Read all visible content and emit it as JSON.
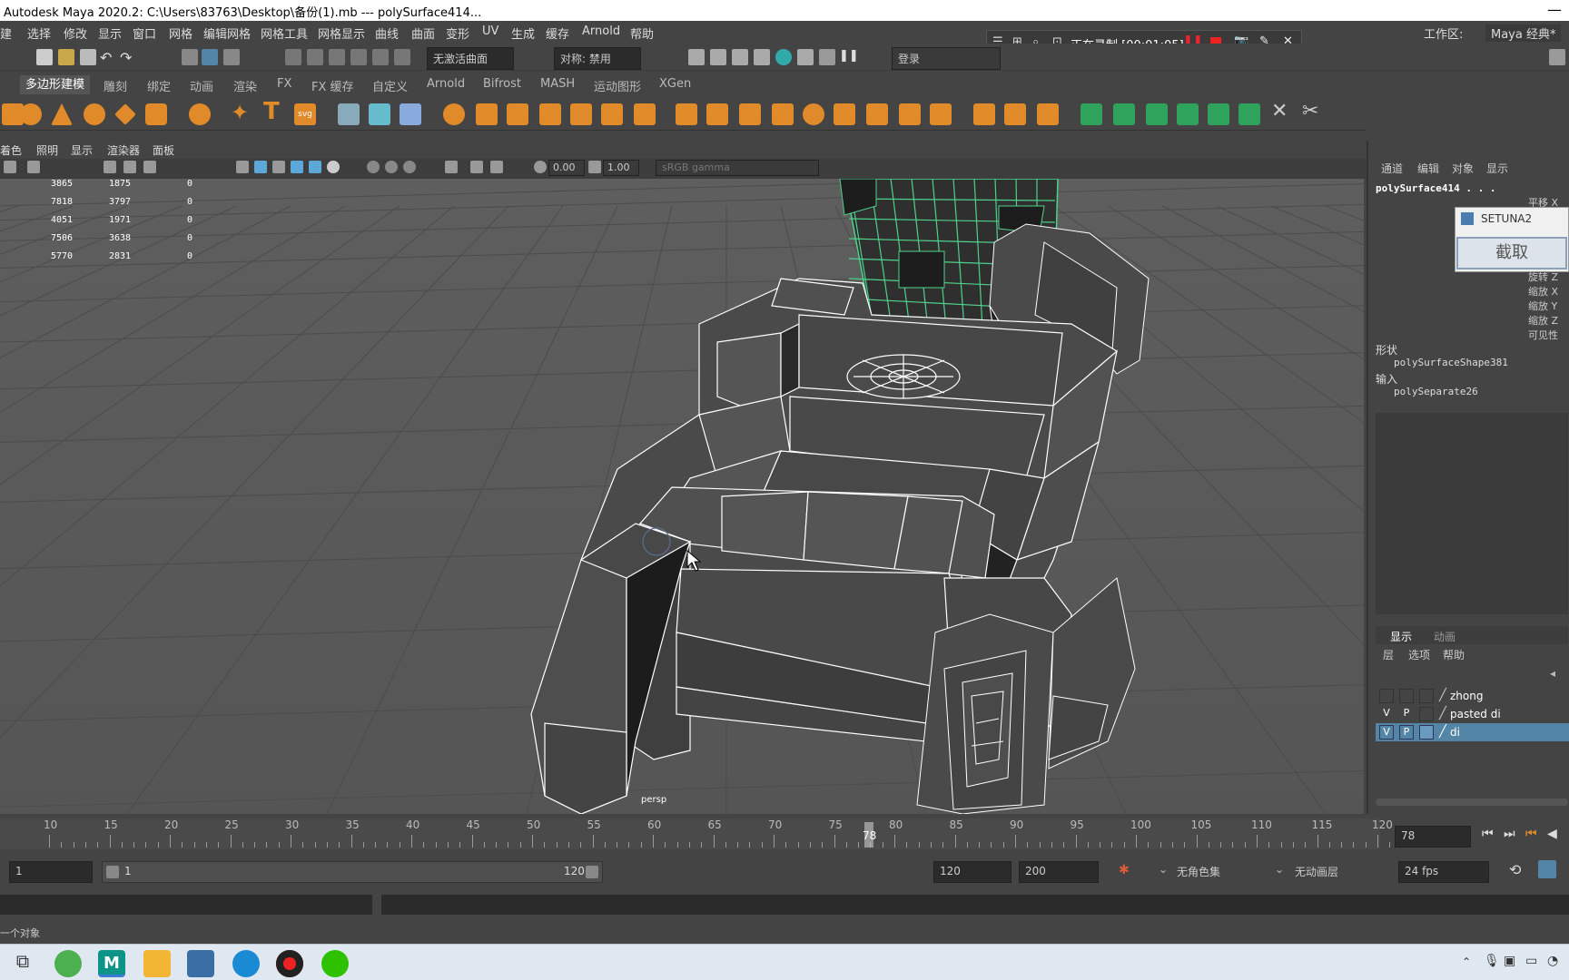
{
  "window": {
    "title": "Autodesk Maya 2020.2: C:\\Users\\83763\\Desktop\\备份(1).mb   ---   polySurface414...",
    "close": "—"
  },
  "menus": [
    "建",
    "选择",
    "修改",
    "显示",
    "窗口",
    "网格",
    "编辑网格",
    "网格工具",
    "网格显示",
    "曲线",
    "曲面",
    "变形",
    "UV",
    "生成",
    "缓存",
    "Arnold",
    "帮助"
  ],
  "recorder": {
    "label": "正在录制 [00:01:05]"
  },
  "workspace": {
    "label": "工作区:",
    "value": "Maya 经典*"
  },
  "statusline": {
    "live_surface": "无激活曲面",
    "symmetry": "对称: 禁用",
    "login": "登录"
  },
  "shelf_tabs": [
    "多边形建模",
    "雕刻",
    "绑定",
    "动画",
    "渲染",
    "FX",
    "FX 缓存",
    "自定义",
    "Arnold",
    "Bifrost",
    "MASH",
    "运动图形",
    "XGen"
  ],
  "panel_menu": [
    "着色",
    "照明",
    "显示",
    "渲染器",
    "面板"
  ],
  "panel_bar": {
    "exposure": "0.00",
    "gamma": "1.00",
    "colorspace": "sRGB gamma"
  },
  "hud": [
    {
      "a": "3865",
      "b": "1875",
      "c": "0"
    },
    {
      "a": "7818",
      "b": "3797",
      "c": "0"
    },
    {
      "a": "4051",
      "b": "1971",
      "c": "0"
    },
    {
      "a": "7506",
      "b": "3638",
      "c": "0"
    },
    {
      "a": "5770",
      "b": "2831",
      "c": "0"
    }
  ],
  "viewport_label": "persp",
  "channel_box": {
    "tabs": [
      "通道",
      "编辑",
      "对象",
      "显示"
    ],
    "object": "polySurface414 . . .",
    "attrs": [
      "平移 X",
      "旋转 Z",
      "缩放 X",
      "缩放 Y",
      "缩放 Z",
      "可见性"
    ],
    "shape_header": "形状",
    "shape": "polySurfaceShape381",
    "input_header": "输入",
    "input": "polySeparate26"
  },
  "setuna": {
    "title": "SETUNA2",
    "button": "截取"
  },
  "layer_editor": {
    "tabs": [
      "显示",
      "动画"
    ],
    "menu": [
      "层",
      "选项",
      "帮助"
    ],
    "layers": [
      {
        "v": "",
        "p": "",
        "name": "zhong",
        "selected": false
      },
      {
        "v": "V",
        "p": "P",
        "name": "pasted  di",
        "selected": false
      },
      {
        "v": "V",
        "p": "P",
        "name": "di",
        "selected": true
      }
    ]
  },
  "timeline": {
    "ticks": [
      "10",
      "15",
      "20",
      "25",
      "30",
      "35",
      "40",
      "45",
      "50",
      "55",
      "60",
      "65",
      "70",
      "75",
      "80",
      "85",
      "90",
      "95",
      "100",
      "105",
      "110",
      "115",
      "120"
    ],
    "current": "78"
  },
  "range": {
    "start": "1",
    "inner_start": "1",
    "inner_end": "120",
    "end": "120",
    "anim_end": "200",
    "char_set": "无角色集",
    "anim_layer": "无动画层",
    "fps": "24 fps"
  },
  "helpline": "一个对象",
  "colors": {
    "accent": "#5285a6",
    "wire": "#4fd18b",
    "bg": "#444444"
  }
}
